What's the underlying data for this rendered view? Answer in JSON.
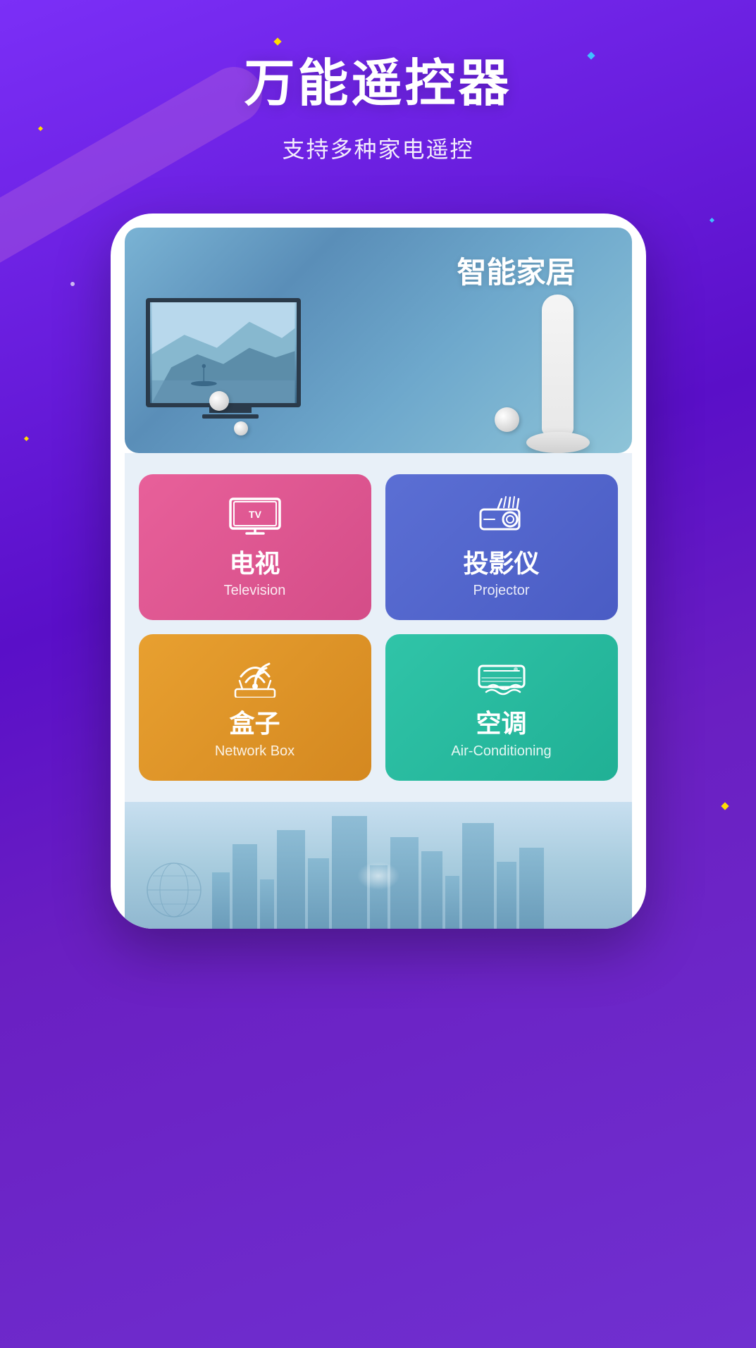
{
  "app": {
    "title": "万能遥控器",
    "subtitle": "支持多种家电遥控",
    "bg_colors": {
      "primary": "#7b2ff7",
      "secondary": "#5a0fc8"
    }
  },
  "banner": {
    "title": "智能家居"
  },
  "grid": {
    "items": [
      {
        "id": "tv",
        "name_zh": "电视",
        "name_en": "Television",
        "color": "tv"
      },
      {
        "id": "projector",
        "name_zh": "投影仪",
        "name_en": "Projector",
        "color": "projector"
      },
      {
        "id": "network",
        "name_zh": "盒子",
        "name_en": "Network Box",
        "color": "network"
      },
      {
        "id": "ac",
        "name_zh": "空调",
        "name_en": "Air-Conditioning",
        "color": "ac"
      }
    ]
  }
}
